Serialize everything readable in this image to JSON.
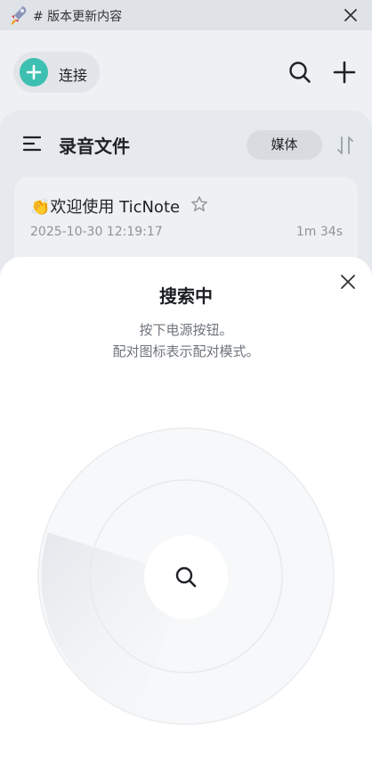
{
  "banner": {
    "text": "# 版本更新内容",
    "icons": {
      "leading": "rocket-icon",
      "trailing": "close-icon"
    }
  },
  "header": {
    "connect_label": "连接",
    "icons": [
      "plus-icon",
      "search-icon",
      "add-icon"
    ]
  },
  "files": {
    "title": "录音文件",
    "filter_label": "媒体",
    "recordings": [
      {
        "title": "👏欢迎使用 TicNote",
        "date": "2025-10-30 12:19:17",
        "duration": "1m 34s"
      }
    ]
  },
  "sheet": {
    "title": "搜索中",
    "hint_line1": "按下电源按钮。",
    "hint_line2": "配对图标表示配对模式。"
  },
  "colors": {
    "accent": "#3dc0b1",
    "sheet_background": "#ffffff",
    "muted_text": "#6f757c"
  }
}
